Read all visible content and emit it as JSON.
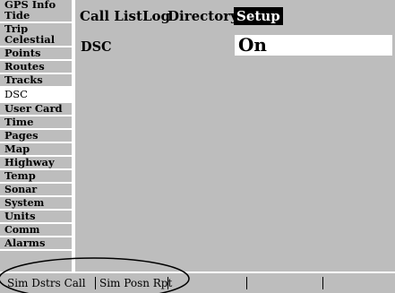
{
  "side_menu": {
    "items": [
      {
        "label": "GPS Info"
      },
      {
        "label": "Tide"
      },
      {
        "label": "Trip"
      },
      {
        "label": "Celestial"
      },
      {
        "label": "Points"
      },
      {
        "label": "Routes"
      },
      {
        "label": "Tracks"
      },
      {
        "label": "DSC"
      },
      {
        "label": "User Card"
      },
      {
        "label": "Time"
      },
      {
        "label": "Pages"
      },
      {
        "label": "Map"
      },
      {
        "label": "Highway"
      },
      {
        "label": "Temp"
      },
      {
        "label": "Sonar"
      },
      {
        "label": "System"
      },
      {
        "label": "Units"
      },
      {
        "label": "Comm"
      },
      {
        "label": "Alarms"
      }
    ],
    "selected": "DSC"
  },
  "tabs": {
    "items": [
      {
        "label": "Call List"
      },
      {
        "label": "Log"
      },
      {
        "label": "Directory"
      },
      {
        "label": "Setup"
      }
    ],
    "active": "Setup"
  },
  "setup": {
    "dsc_label": "DSC",
    "dsc_value": "On"
  },
  "softkeys": {
    "key1": "Sim Dstrs Call",
    "key2": "Sim Posn Rpt"
  },
  "colors": {
    "background_gray": "#bdbdbd",
    "highlight": "#ffffff",
    "active_tab": "#000000"
  }
}
